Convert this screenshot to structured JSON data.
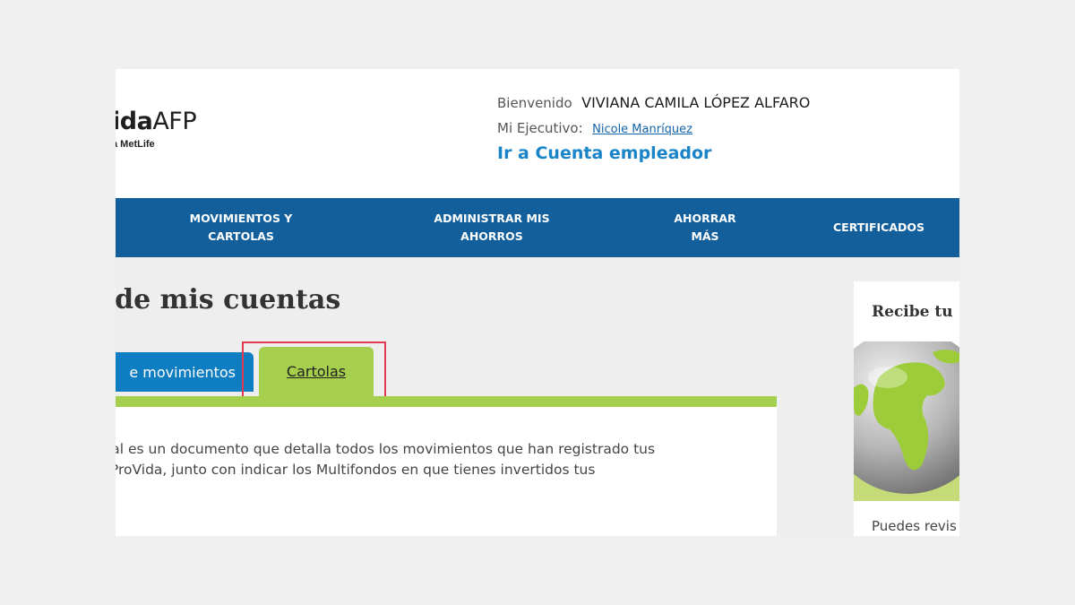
{
  "header": {
    "logo": {
      "brand_bold": "ida",
      "brand_light": "AFP",
      "tagline": "a MetLife"
    },
    "welcome_label": "Bienvenido",
    "user_name": "VIVIANA CAMILA LÓPEZ ALFARO",
    "executive_label": "Mi Ejecutivo:",
    "executive_name": "Nicole Manríquez",
    "employer_link": "Ir a Cuenta empleador"
  },
  "nav": {
    "items": [
      {
        "line1": "MOVIMIENTOS Y",
        "line2": "CARTOLAS"
      },
      {
        "line1": "ADMINISTRAR MIS",
        "line2": "AHORROS"
      },
      {
        "line1": "AHORRAR",
        "line2": "MÁS"
      },
      {
        "line1": "CERTIFICADOS",
        "line2": ""
      }
    ]
  },
  "main": {
    "section_title": "men de mis cuentas",
    "tabs": [
      {
        "label": "e movimientos"
      },
      {
        "label": "Cartolas"
      }
    ],
    "intro_line1": "uatrimestral es un documento que detalla todos los movimientos que han registrado tus",
    "intro_line2": "onales en ProVida, junto con indicar los Multifondos en que tienes invertidos tus"
  },
  "side": {
    "title": "Recibe tu",
    "text": "Puedes revis"
  },
  "colors": {
    "nav_blue": "#125f9c",
    "tab_blue": "#0f7dc2",
    "tab_green": "#a5cf4d",
    "highlight": "#e3384d",
    "link_blue": "#1a84c8"
  }
}
